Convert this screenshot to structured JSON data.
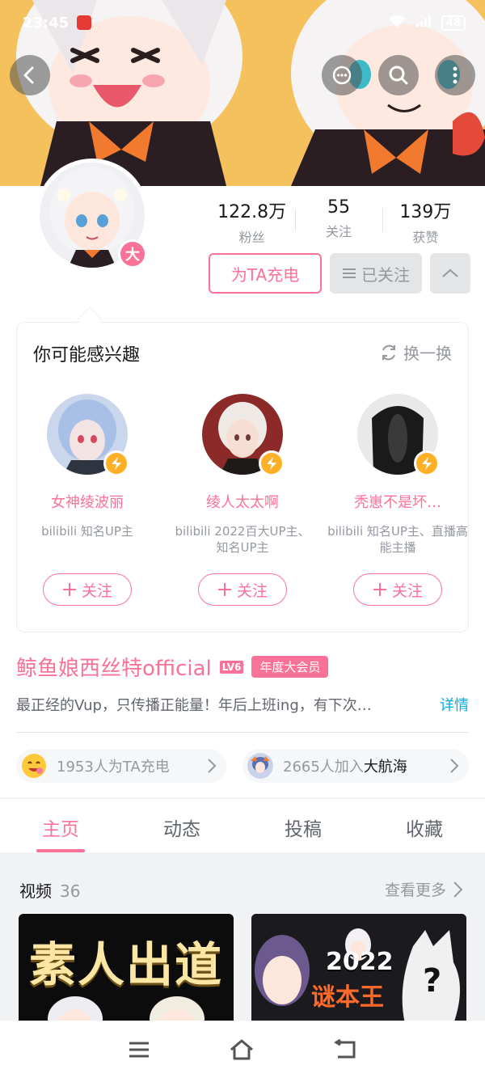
{
  "status_bar": {
    "time": "23:45",
    "battery": "48"
  },
  "header": {
    "back_icon": "back-arrow-icon",
    "chat_icon": "chat-bubble-icon",
    "search_icon": "search-icon",
    "more_icon": "more-vertical-icon"
  },
  "profile": {
    "vip_badge": "大",
    "stats": [
      {
        "value": "122.8万",
        "label": "粉丝"
      },
      {
        "value": "55",
        "label": "关注"
      },
      {
        "value": "139万",
        "label": "获赞"
      }
    ],
    "charge_button": "为TA充电",
    "followed_button": "已关注"
  },
  "recommend": {
    "title": "你可能感兴趣",
    "refresh": "换一换",
    "items": [
      {
        "name": "女神绫波丽",
        "desc": "bilibili 知名UP主",
        "follow": "关注"
      },
      {
        "name": "绫人太太啊",
        "desc": "bilibili 2022百大UP主、知名UP主",
        "follow": "关注"
      },
      {
        "name": "秃崽不是坏…",
        "desc": "bilibili 知名UP主、直播高能主播",
        "follow": "关注"
      }
    ]
  },
  "user": {
    "name": "鲸鱼娘西丝特official",
    "level": "LV6",
    "vip_tag": "年度大会员",
    "bio": "最正经的Vup，只传播正能量！年后上班ing，有下次…",
    "detail_link": "详情"
  },
  "pills": {
    "charge": {
      "gray": "1953人为TA充电",
      "dark": ""
    },
    "fleet": {
      "gray": "2665人加入",
      "dark": "大航海"
    }
  },
  "tabs": [
    "主页",
    "动态",
    "投稿",
    "收藏"
  ],
  "videos": {
    "title": "视频",
    "count": "36",
    "more": "查看更多",
    "thumb1_text": "素人出道",
    "thumb2_text": "2022",
    "thumb2_sub": "谜本王",
    "thumb2_q": "?"
  },
  "colors": {
    "accent": "#fb7299",
    "link": "#00aeec",
    "banner": "#f4c15c"
  }
}
